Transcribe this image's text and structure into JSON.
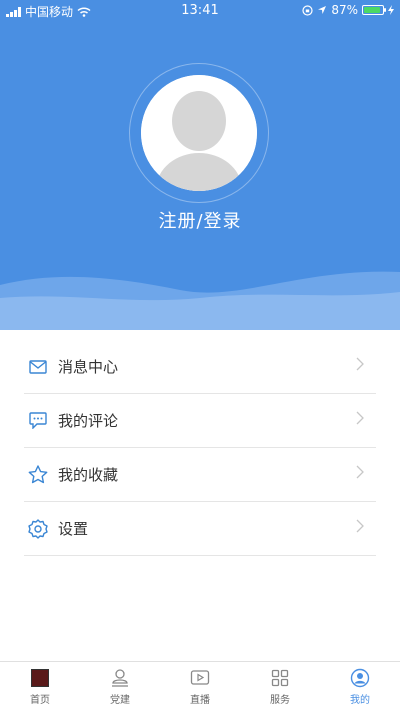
{
  "status_bar": {
    "carrier": "中国移动",
    "time": "13:41",
    "battery": "87%",
    "battery_level": 0.87,
    "icons": [
      "signal-icon",
      "wifi-icon",
      "orientation-lock-icon",
      "location-icon",
      "battery-icon",
      "charging-icon"
    ]
  },
  "colors": {
    "accent": "#4a8fe2",
    "header_bg": "#4a8fe2",
    "menu_icon": "#3a86d4",
    "text": "#333333",
    "divider": "#e5e5e5"
  },
  "profile": {
    "login_label": "注册/登录",
    "avatar_icon": "default-avatar-icon"
  },
  "menu": {
    "items": [
      {
        "label": "消息中心",
        "icon": "mail-icon"
      },
      {
        "label": "我的评论",
        "icon": "comment-icon"
      },
      {
        "label": "我的收藏",
        "icon": "star-icon"
      },
      {
        "label": "设置",
        "icon": "gear-icon"
      }
    ]
  },
  "tabbar": {
    "active_index": 4,
    "tabs": [
      {
        "label": "首页",
        "icon": "home-thumbnail-icon"
      },
      {
        "label": "党建",
        "icon": "party-building-icon"
      },
      {
        "label": "直播",
        "icon": "live-play-icon"
      },
      {
        "label": "服务",
        "icon": "grid-icon"
      },
      {
        "label": "我的",
        "icon": "profile-icon"
      }
    ]
  }
}
